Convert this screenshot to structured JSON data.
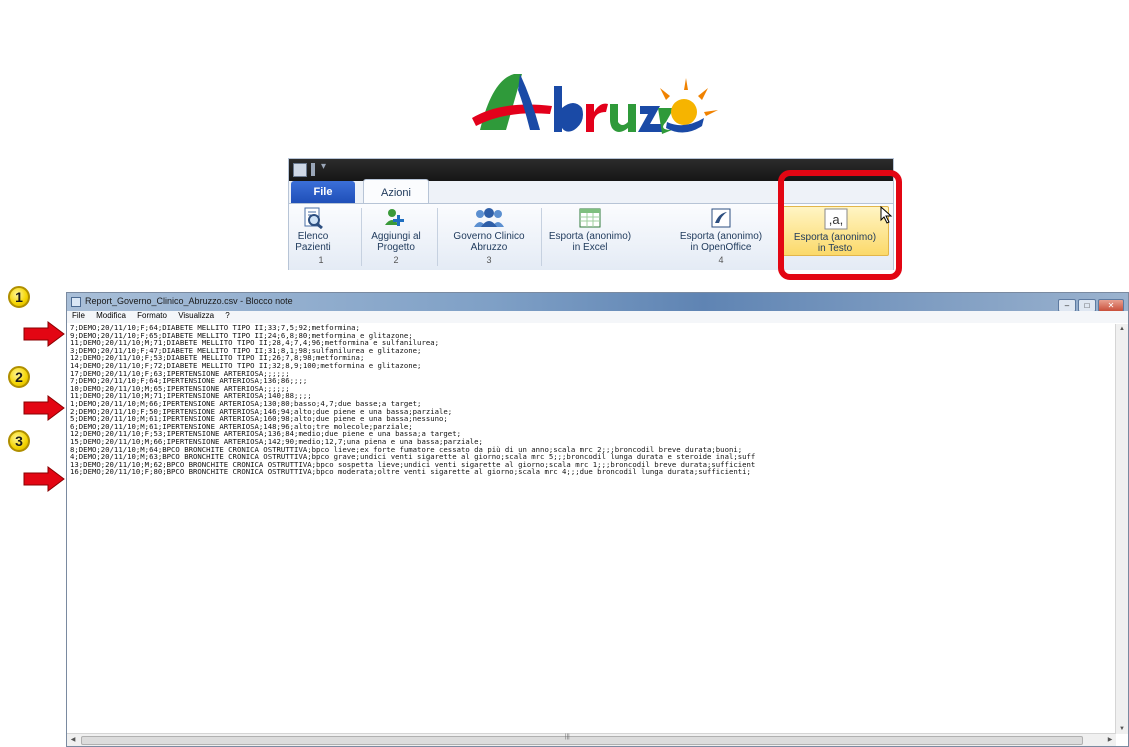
{
  "logo": {
    "text": "Abruzzo",
    "colors": [
      "#2f9a3a",
      "#e3001b",
      "#1a4aa6",
      "#f6b400",
      "#f08200"
    ]
  },
  "ribbon": {
    "file_tab": "File",
    "active_tab": "Azioni",
    "buttons": [
      {
        "label": "Elenco\nPazienti",
        "icon": "patient-list-search-icon"
      },
      {
        "label": "Aggiungi al\nProgetto",
        "icon": "add-to-project-icon"
      },
      {
        "label": "Governo Clinico\nAbruzzo",
        "icon": "people-group-icon"
      },
      {
        "label": "Esporta (anonimo)\nin Excel",
        "icon": "excel-export-icon"
      },
      {
        "label": "Esporta (anonimo)\nin OpenOffice",
        "icon": "openoffice-export-icon"
      },
      {
        "label": "Esporta (anonimo)\nin Testo",
        "icon": "text-export-icon",
        "icon_text": ",a,"
      }
    ],
    "groups": [
      "1",
      "2",
      "3",
      "4"
    ]
  },
  "notepad": {
    "title": "Report_Governo_Clinico_Abruzzo.csv - Blocco note",
    "menu": [
      "File",
      "Modifica",
      "Formato",
      "Visualizza",
      "?"
    ],
    "lines": [
      "7;DEMO;20/11/10;F;64;DIABETE MELLITO TIPO II;33;7,5;92;metformina;",
      "9;DEMO;20/11/10;F;65;DIABETE MELLITO TIPO II;24;6,8;80;metformina e glitazone;",
      "11;DEMO;20/11/10;M;71;DIABETE MELLITO TIPO II;28,4;7,4;96;metformina e sulfanilurea;",
      "3;DEMO;20/11/10;F;47;DIABETE MELLITO TIPO II;31;8,1;98;sulfanilurea e glitazone;",
      "12;DEMO;20/11/10;F;53;DIABETE MELLITO TIPO II;26;7,8;98;metformina;",
      "14;DEMO;20/11/10;F;72;DIABETE MELLITO TIPO II;32;8,9;100;metformina e glitazone;",
      "17;DEMO;20/11/10;F;63;IPERTENSIONE ARTERIOSA;;;;;;",
      "7;DEMO;20/11/10;F;64;IPERTENSIONE ARTERIOSA;136;86;;;;",
      "10;DEMO;20/11/10;M;65;IPERTENSIONE ARTERIOSA;;;;;;",
      "11;DEMO;20/11/10;M;71;IPERTENSIONE ARTERIOSA;140;88;;;;",
      "1;DEMO;20/11/10;M;66;IPERTENSIONE ARTERIOSA;130;80;basso;4,7;due basse;a target;",
      "2;DEMO;20/11/10;F;50;IPERTENSIONE ARTERIOSA;146;94;alto;due piene e una bassa;parziale;",
      "5;DEMO;20/11/10;M;61;IPERTENSIONE ARTERIOSA;160;98;alto;due piene e una bassa;nessuno;",
      "6;DEMO;20/11/10;M;61;IPERTENSIONE ARTERIOSA;148;96;alto;tre molecole;parziale;",
      "12;DEMO;20/11/10;F;53;IPERTENSIONE ARTERIOSA;136;84;medio;due piene e una bassa;a target;",
      "15;DEMO;20/11/10;M;66;IPERTENSIONE ARTERIOSA;142;90;medio;12,7;una piena e una bassa;parziale;",
      "8;DEMO;20/11/10;M;64;BPCO BRONCHITE CRONICA OSTRUTTIVA;bpco lieve;ex forte fumatore cessato da più di un anno;scala mrc 2;;;broncodil breve durata;buoni;",
      "4;DEMO;20/11/10;M;63;BPCO BRONCHITE CRONICA OSTRUTTIVA;bpco grave;undici venti sigarette al giorno;scala mrc 5;;;broncodil lunga durata e steroide inal;suff",
      "13;DEMO;20/11/10;M;62;BPCO BRONCHITE CRONICA OSTRUTTIVA;bpco sospetta lieve;undici venti sigarette al giorno;scala mrc 1;;;broncodil breve durata;sufficient",
      "16;DEMO;20/11/10;F;80;BPCO BRONCHITE CRONICA OSTRUTTIVA;bpco moderata;oltre venti sigarette al giorno;scala mrc 4;;;due broncodil lunga durata;sufficienti;"
    ]
  },
  "badges": [
    "1",
    "2",
    "3"
  ],
  "colors": {
    "highlight": "#e30613",
    "arrow": "#e30613",
    "badge": "#f4d400",
    "file_tab": "#2456c8"
  }
}
